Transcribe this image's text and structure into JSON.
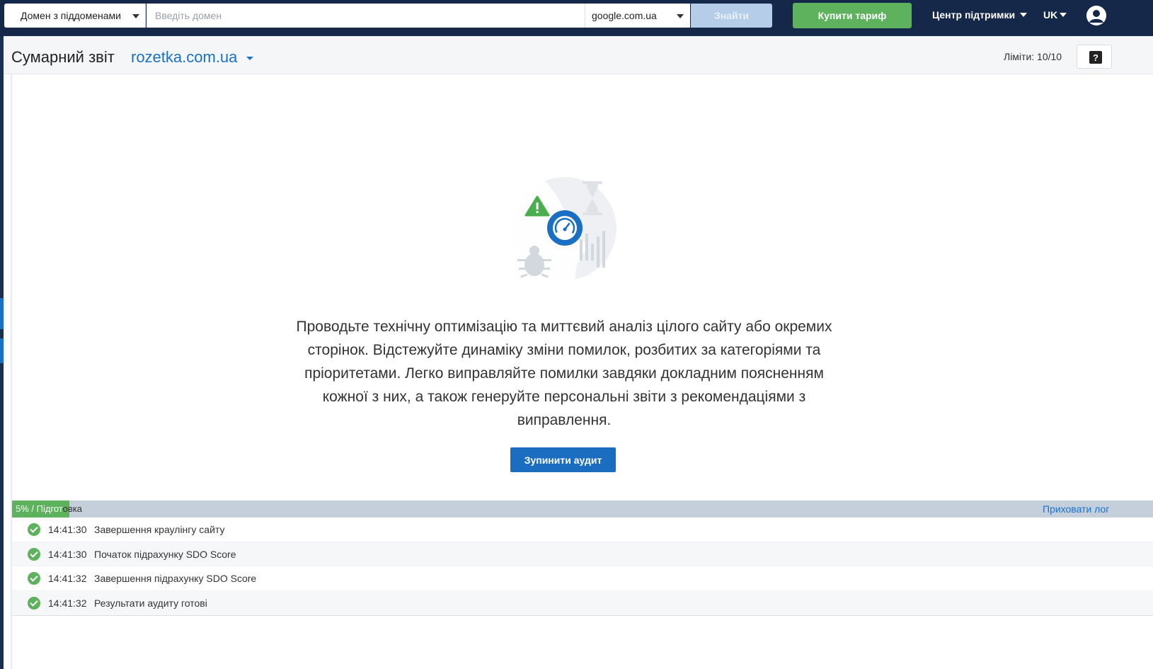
{
  "topbar": {
    "domain_scope": "Домен з піддоменами",
    "domain_placeholder": "Введіть домен",
    "search_engine": "google.com.ua",
    "find_label": "Знайти",
    "buy_label": "Купити тариф",
    "support_label": "Центр підтримки",
    "language": "UK",
    "icons": [
      "chevron-down-icon",
      "user-avatar-icon"
    ]
  },
  "header": {
    "title": "Сумарний звіт",
    "domain": "rozetka.com.ua",
    "limits": "Ліміти: 10/10",
    "help_symbol": "?"
  },
  "main": {
    "description": "Проводьте технічну оптимізацію та миттєвий аналіз цілого сайту або окремих сторінок. Відстежуйте динаміку зміни помилок, розбитих за категоріями та пріоритетами. Легко виправляйте помилки завдяки докладним поясненням кожної з них, а також генеруйте персональні звіти з рекомендаціями з виправлення.",
    "stop_label": "Зупинити аудит",
    "illustration_icons": [
      "warning-icon",
      "speedometer-icon",
      "bug-icon",
      "bar-chart-icon",
      "hourglass-icon"
    ]
  },
  "progress": {
    "text_light": "5% / Підгот",
    "text_dark": "овка",
    "percent": 5,
    "hide_log_label": "Приховати лог",
    "colors": {
      "fill": "#5eb25d",
      "track": "#c5cfdc"
    }
  },
  "log": [
    {
      "time": "14:41:30",
      "message": "Завершення краулінгу сайту"
    },
    {
      "time": "14:41:30",
      "message": "Початок підрахунку SDO Score"
    },
    {
      "time": "14:41:32",
      "message": "Завершення підрахунку SDO Score"
    },
    {
      "time": "14:41:32",
      "message": "Результати аудиту готові"
    }
  ],
  "colors": {
    "topbar": "#15284a",
    "accent_blue": "#1a72c4",
    "green": "#5eb25d"
  }
}
